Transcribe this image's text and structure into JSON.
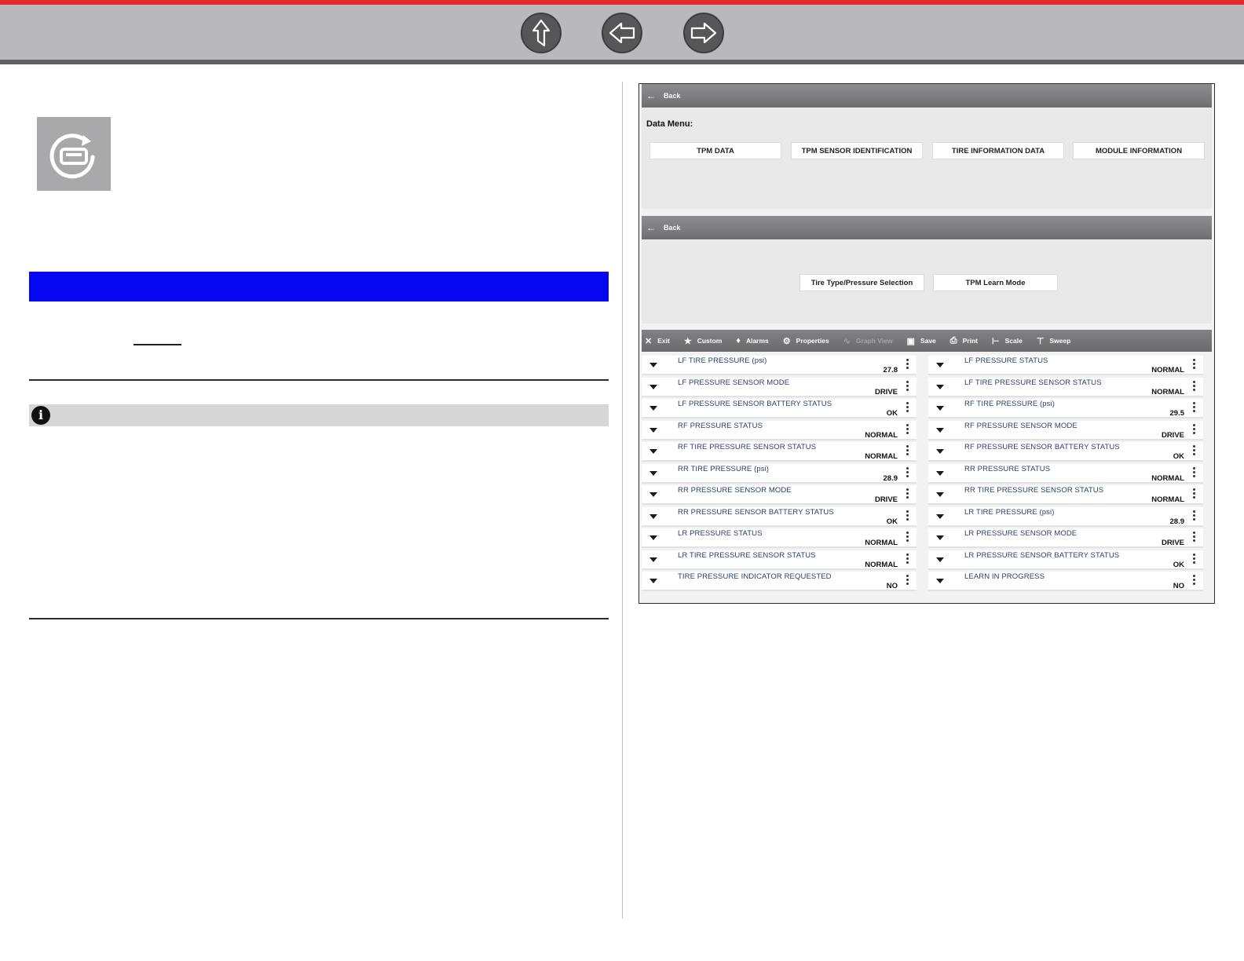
{
  "nav": {
    "up_icon": "up-arrow-icon",
    "back_icon": "left-arrow-icon",
    "forward_icon": "right-arrow-icon"
  },
  "screenshot": {
    "header1": {
      "back_label": "Back"
    },
    "data_menu": {
      "title": "Data Menu:",
      "buttons": [
        "TPM DATA",
        "TPM SENSOR IDENTIFICATION",
        "TIRE INFORMATION DATA",
        "MODULE INFORMATION"
      ]
    },
    "header2": {
      "back_label": "Back"
    },
    "sub_menu": {
      "buttons": [
        "Tire Type/Pressure Selection",
        "TPM Learn Mode"
      ]
    },
    "toolbar": {
      "exit": "Exit",
      "custom": "Custom",
      "alarms": "Alarms",
      "properties": "Properties",
      "graph_view": "Graph View",
      "save": "Save",
      "print": "Print",
      "scale": "Scale",
      "sweep": "Sweep"
    },
    "pids_left": [
      {
        "name": "LF TIRE PRESSURE (psi)",
        "value": "27.8"
      },
      {
        "name": "LF PRESSURE SENSOR MODE",
        "value": "DRIVE"
      },
      {
        "name": "LF PRESSURE SENSOR BATTERY STATUS",
        "value": "OK"
      },
      {
        "name": "RF PRESSURE STATUS",
        "value": "NORMAL"
      },
      {
        "name": "RF TIRE PRESSURE SENSOR STATUS",
        "value": "NORMAL"
      },
      {
        "name": "RR TIRE PRESSURE (psi)",
        "value": "28.9"
      },
      {
        "name": "RR PRESSURE SENSOR MODE",
        "value": "DRIVE"
      },
      {
        "name": "RR PRESSURE SENSOR BATTERY STATUS",
        "value": "OK"
      },
      {
        "name": "LR PRESSURE STATUS",
        "value": "NORMAL"
      },
      {
        "name": "LR TIRE PRESSURE SENSOR STATUS",
        "value": "NORMAL"
      },
      {
        "name": "TIRE PRESSURE INDICATOR REQUESTED",
        "value": "NO"
      }
    ],
    "pids_right": [
      {
        "name": "LF PRESSURE STATUS",
        "value": "NORMAL"
      },
      {
        "name": "LF TIRE PRESSURE SENSOR STATUS",
        "value": "NORMAL"
      },
      {
        "name": "RF TIRE PRESSURE (psi)",
        "value": "29.5"
      },
      {
        "name": "RF PRESSURE SENSOR MODE",
        "value": "DRIVE"
      },
      {
        "name": "RF PRESSURE SENSOR BATTERY STATUS",
        "value": "OK"
      },
      {
        "name": "RR PRESSURE STATUS",
        "value": "NORMAL"
      },
      {
        "name": "RR TIRE PRESSURE SENSOR STATUS",
        "value": "NORMAL"
      },
      {
        "name": "LR TIRE PRESSURE (psi)",
        "value": "28.9"
      },
      {
        "name": "LR PRESSURE SENSOR MODE",
        "value": "DRIVE"
      },
      {
        "name": "LR PRESSURE SENSOR BATTERY STATUS",
        "value": "OK"
      },
      {
        "name": "LEARN IN PROGRESS",
        "value": "NO"
      }
    ]
  }
}
